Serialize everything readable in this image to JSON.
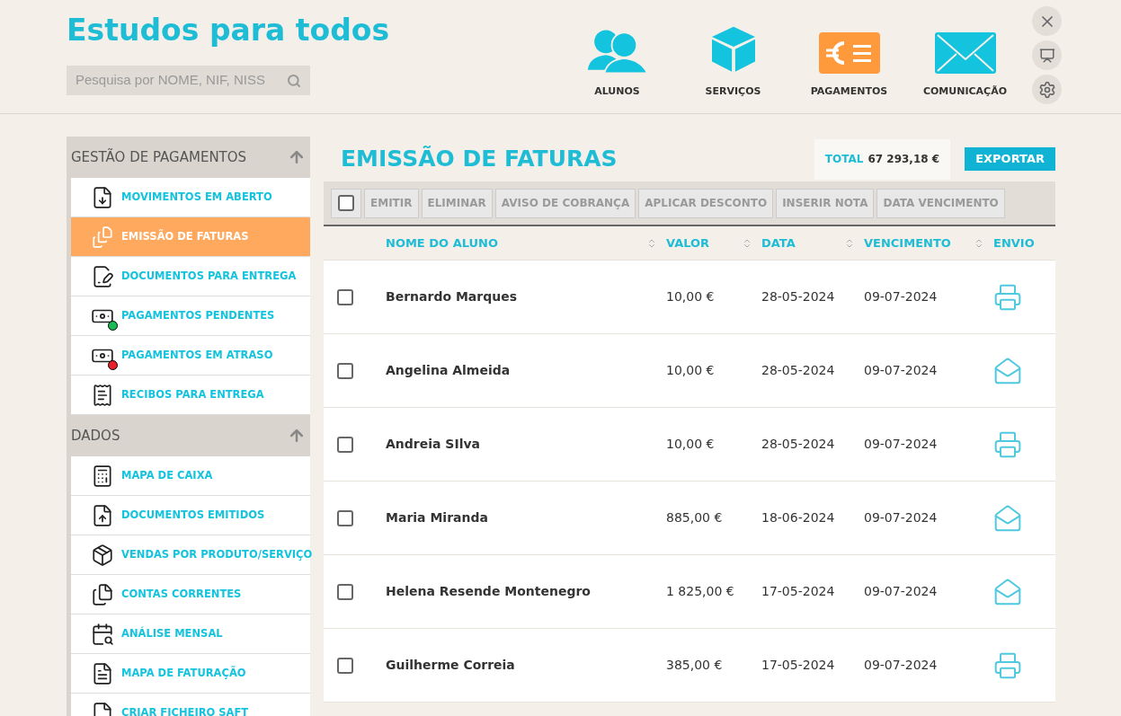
{
  "brand": "Estudos para todos",
  "search": {
    "placeholder": "Pesquisa por NOME, NIF, NISS"
  },
  "nav": [
    {
      "label": "ALUNOS"
    },
    {
      "label": "SERVIÇOS"
    },
    {
      "label": "PAGAMENTOS"
    },
    {
      "label": "COMUNICAÇÃO"
    }
  ],
  "sidebar": [
    {
      "title": "GESTÃO DE PAGAMENTOS",
      "items": [
        {
          "label": "MOVIMENTOS EM ABERTO",
          "selected": false
        },
        {
          "label": "EMISSÃO DE FATURAS",
          "selected": true
        },
        {
          "label": "DOCUMENTOS PARA ENTREGA",
          "selected": false
        },
        {
          "label": "PAGAMENTOS PENDENTES",
          "selected": false,
          "color": "#1db954"
        },
        {
          "label": "PAGAMENTOS EM ATRASO",
          "selected": false,
          "color": "#e8202a"
        },
        {
          "label": "RECIBOS PARA ENTREGA",
          "selected": false
        }
      ]
    },
    {
      "title": "DADOS",
      "items": [
        {
          "label": "MAPA DE CAIXA",
          "selected": false
        },
        {
          "label": "DOCUMENTOS EMITIDOS",
          "selected": false
        },
        {
          "label": "VENDAS POR PRODUTO/SERVIÇO",
          "selected": false
        },
        {
          "label": "CONTAS CORRENTES",
          "selected": false
        },
        {
          "label": "ANÁLISE MENSAL",
          "selected": false
        },
        {
          "label": "MAPA DE FATURAÇÃO",
          "selected": false
        },
        {
          "label": "CRIAR FICHEIRO SAFT",
          "selected": false
        }
      ]
    }
  ],
  "page_title": "EMISSÃO DE FATURAS",
  "total": {
    "label": "TOTAL",
    "value": "67 293,18 €"
  },
  "export_button": "EXPORTAR",
  "toolbar": {
    "select_all": false,
    "actions": [
      {
        "label": "EMITIR",
        "disabled": true
      },
      {
        "label": "ELIMINAR",
        "disabled": true
      },
      {
        "label": "AVISO DE COBRANÇA",
        "disabled": true
      },
      {
        "label": "APLICAR DESCONTO",
        "disabled": true
      },
      {
        "label": "INSERIR NOTA",
        "disabled": true
      },
      {
        "label": "DATA VENCIMENTO",
        "disabled": true
      }
    ]
  },
  "table": {
    "columns": [
      "NOME DO ALUNO",
      "VALOR",
      "DATA",
      "VENCIMENTO",
      "ENVIO"
    ],
    "rows": [
      {
        "checked": false,
        "name": "Bernardo Marques",
        "value": "10,00 €",
        "date": "28-05-2024",
        "due": "09-07-2024",
        "kind": "print"
      },
      {
        "checked": false,
        "name": "Angelina Almeida",
        "value": "10,00 €",
        "date": "28-05-2024",
        "due": "09-07-2024",
        "kind": "email"
      },
      {
        "checked": false,
        "name": "Andreia SIlva",
        "value": "10,00 €",
        "date": "28-05-2024",
        "due": "09-07-2024",
        "kind": "print"
      },
      {
        "checked": false,
        "name": "Maria Miranda",
        "value": "885,00 €",
        "date": "18-06-2024",
        "due": "09-07-2024",
        "kind": "email"
      },
      {
        "checked": false,
        "name": "Helena Resende Montenegro",
        "value": "1 825,00 €",
        "date": "17-05-2024",
        "due": "09-07-2024",
        "kind": "email"
      },
      {
        "checked": false,
        "name": "Guilherme Correia",
        "value": "385,00 €",
        "date": "17-05-2024",
        "due": "09-07-2024",
        "kind": "print"
      }
    ]
  }
}
